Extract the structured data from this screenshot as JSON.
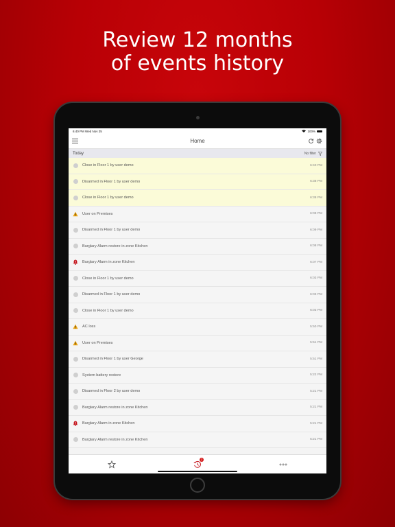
{
  "headline": {
    "line1": "Review 12 months",
    "line2": "of events history"
  },
  "statusbar": {
    "time": "6:40 PM",
    "date": "Wed Nov 25",
    "battery": "100%"
  },
  "navbar": {
    "title": "Home"
  },
  "section": {
    "label": "Today",
    "filter_label": "No filter"
  },
  "colors": {
    "brand": "#b80005",
    "highlight_row": "#fbfbd8",
    "warning": "#e9a20f",
    "alarm": "#c4121a"
  },
  "events": [
    {
      "icon": "info-icon",
      "text": "Close in Floor 1 by user demo",
      "time": "6:40 PM",
      "highlight": true
    },
    {
      "icon": "info-icon",
      "text": "Disarmed in Floor 1 by user demo",
      "time": "6:38 PM",
      "highlight": true
    },
    {
      "icon": "info-icon",
      "text": "Close in Floor 1 by user demo",
      "time": "6:38 PM",
      "highlight": true
    },
    {
      "icon": "warning-icon",
      "text": "User on Premises",
      "time": "6:09 PM",
      "highlight": false
    },
    {
      "icon": "info-icon",
      "text": "Disarmed in Floor 1 by user demo",
      "time": "6:09 PM",
      "highlight": false
    },
    {
      "icon": "info-icon",
      "text": "Burglary Alarm restore in zone Kitchen",
      "time": "6:08 PM",
      "highlight": false
    },
    {
      "icon": "alarm-bell-icon",
      "text": "Burglary Alarm in zone Kitchen",
      "time": "6:07 PM",
      "highlight": false
    },
    {
      "icon": "info-icon",
      "text": "Close in Floor 1 by user demo",
      "time": "6:03 PM",
      "highlight": false
    },
    {
      "icon": "info-icon",
      "text": "Disarmed in Floor 1 by user demo",
      "time": "6:03 PM",
      "highlight": false
    },
    {
      "icon": "info-icon",
      "text": "Close in Floor 1 by user demo",
      "time": "6:03 PM",
      "highlight": false
    },
    {
      "icon": "warning-icon",
      "text": "AC loss",
      "time": "5:50 PM",
      "highlight": false
    },
    {
      "icon": "warning-icon",
      "text": "User on Premises",
      "time": "5:51 PM",
      "highlight": false
    },
    {
      "icon": "info-icon",
      "text": "Disarmed in Floor 1 by user George",
      "time": "5:51 PM",
      "highlight": false
    },
    {
      "icon": "info-icon",
      "text": "System battery restore",
      "time": "5:22 PM",
      "highlight": false
    },
    {
      "icon": "info-icon",
      "text": "Disarmed in Floor 2 by user demo",
      "time": "5:21 PM",
      "highlight": false
    },
    {
      "icon": "info-icon",
      "text": "Burglary Alarm restore in zone Kitchen",
      "time": "5:21 PM",
      "highlight": false
    },
    {
      "icon": "alarm-bell-icon",
      "text": "Burglary Alarm in zone Kitchen",
      "time": "5:21 PM",
      "highlight": false
    },
    {
      "icon": "info-icon",
      "text": "Burglary Alarm restore in zone Kitchen",
      "time": "5:21 PM",
      "highlight": false
    }
  ],
  "tabbar": {
    "tabs": [
      {
        "icon": "star-icon"
      },
      {
        "icon": "history-icon",
        "badge": "2"
      },
      {
        "icon": "more-dots-icon"
      }
    ]
  }
}
